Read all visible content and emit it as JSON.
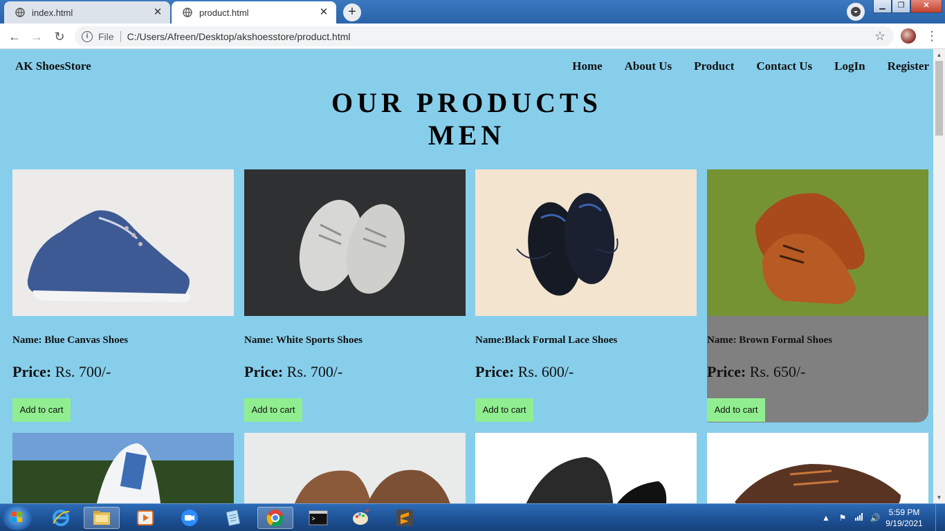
{
  "browser": {
    "tabs": [
      {
        "label": "index.html",
        "active": false
      },
      {
        "label": "product.html",
        "active": true
      }
    ],
    "address": {
      "scheme": "File",
      "url": "C:/Users/Afreen/Desktop/akshoesstore/product.html"
    }
  },
  "site": {
    "brand": "AK ShoesStore",
    "nav": [
      "Home",
      "About Us",
      "Product",
      "Contact Us",
      "LogIn",
      "Register"
    ],
    "heading_line1": "OUR PRODUCTS",
    "heading_line2": "MEN"
  },
  "products": [
    {
      "name": "Name: Blue Canvas Shoes",
      "price_label": "Price:",
      "price_value": "Rs. 700/-",
      "button": "Add to cart",
      "icon": "blue-canvas-shoe"
    },
    {
      "name": "Name: White Sports Shoes",
      "price_label": "Price:",
      "price_value": "Rs. 700/-",
      "button": "Add to cart",
      "icon": "white-sports-shoe"
    },
    {
      "name": "Name:Black Formal Lace Shoes",
      "price_label": "Price:",
      "price_value": "Rs. 600/-",
      "button": "Add to cart",
      "icon": "black-formal-shoe"
    },
    {
      "name": "Name: Brown Formal Shoes",
      "price_label": "Price:",
      "price_value": "Rs. 650/-",
      "button": "Add to cart",
      "icon": "brown-formal-shoe"
    }
  ],
  "taskbar": {
    "time": "5:59 PM",
    "date": "9/19/2021"
  },
  "colors": {
    "page_bg": "#87ceeb",
    "button_bg": "#90ee90",
    "hover_card_bg": "#808080"
  }
}
